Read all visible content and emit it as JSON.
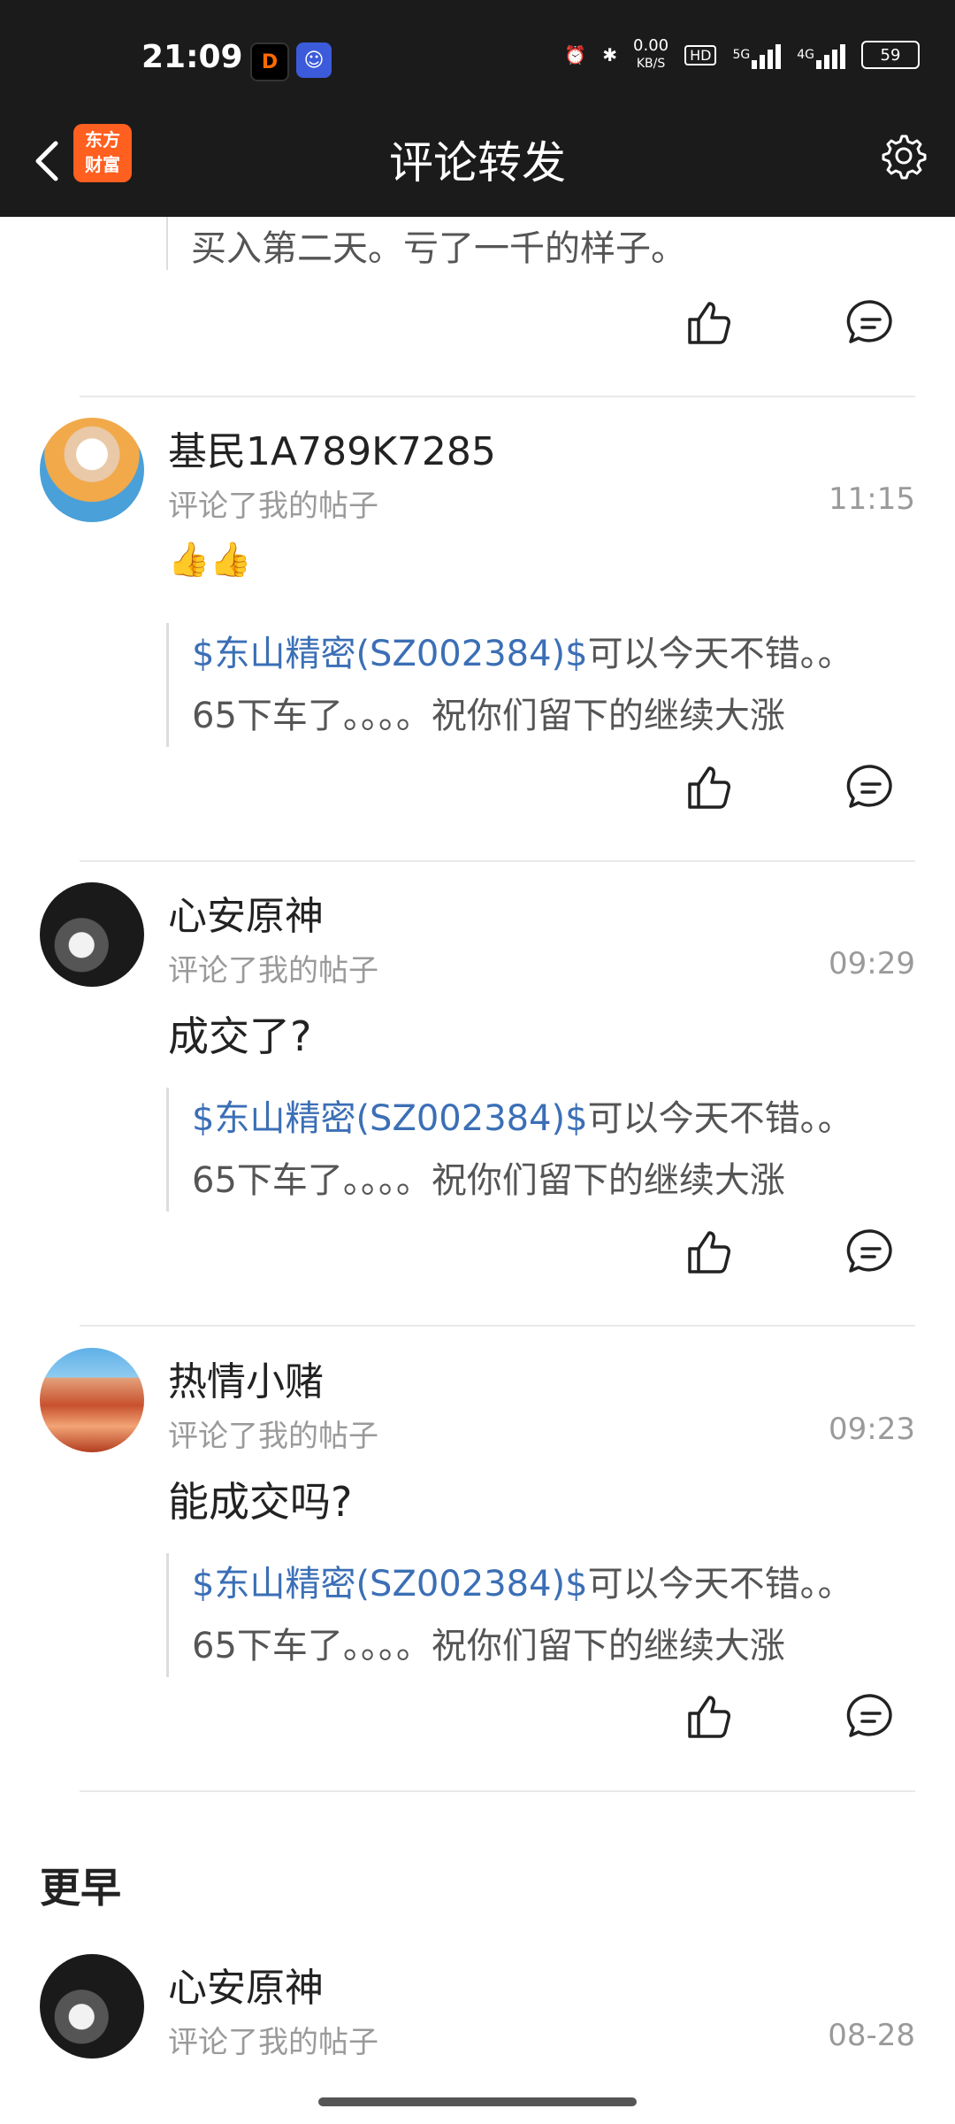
{
  "status_bar": {
    "time": "21:09",
    "net_speed": "0.00",
    "net_unit": "KB/S",
    "hd": "HD",
    "sig1": "5G",
    "sig2": "4G",
    "battery": "59"
  },
  "header": {
    "logo_line1": "东方",
    "logo_line2": "财富",
    "title": "评论转发"
  },
  "feed": {
    "tail_text": "买入第二天。亏了一千的样子。",
    "items": [
      {
        "name": "基民1A789K7285",
        "subtitle": "评论了我的帖子",
        "time": "11:15",
        "body": "👍👍",
        "quote_link": "$东山精密(SZ002384)$",
        "quote_rest1": "可以今天不错。。",
        "quote_line2": "65下车了。。。。祝你们留下的继续大涨"
      },
      {
        "name": "心安原神",
        "subtitle": "评论了我的帖子",
        "time": "09:29",
        "body": "成交了?",
        "quote_link": "$东山精密(SZ002384)$",
        "quote_rest1": "可以今天不错。。",
        "quote_line2": "65下车了。。。。祝你们留下的继续大涨"
      },
      {
        "name": "热情小赌",
        "subtitle": "评论了我的帖子",
        "time": "09:23",
        "body": "能成交吗?",
        "quote_link": "$东山精密(SZ002384)$",
        "quote_rest1": "可以今天不错。。",
        "quote_line2": "65下车了。。。。祝你们留下的继续大涨"
      }
    ],
    "section_earlier": "更早",
    "earlier_item": {
      "name": "心安原神",
      "subtitle": "评论了我的帖子",
      "time": "08-28"
    }
  },
  "colors": {
    "header_bg": "#1b1b1b",
    "logo": "#ff5f1f",
    "link": "#3b6fb6"
  }
}
